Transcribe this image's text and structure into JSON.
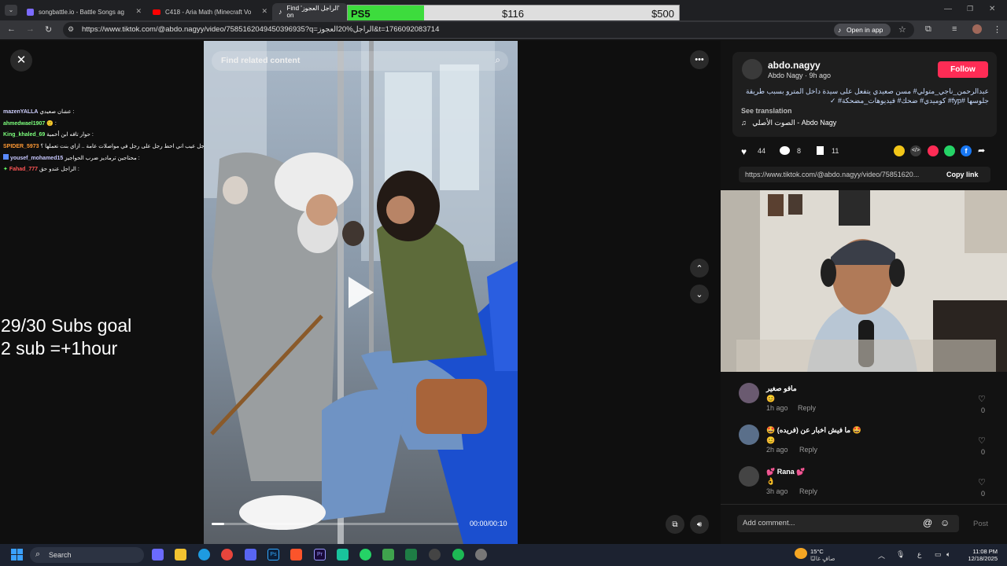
{
  "browser": {
    "tabs": [
      {
        "title": "songbattle.io - Battle Songs ag",
        "icon": "songbattle-icon"
      },
      {
        "title": "C418 - Aria Math (Minecraft Vo",
        "icon": "youtube-icon"
      },
      {
        "title": "Find 'الراجل العجوز' on",
        "icon": "tiktok-icon"
      }
    ],
    "url": "https://www.tiktok.com/@abdo.nagyy/video/7585162049450396935?q=الراجل%20العجوز&t=1766092083714",
    "open_in_app": "Open in app"
  },
  "overlay": {
    "goal_label": "PS5",
    "current": "$116",
    "target": "$500",
    "progress_fraction": 0.23
  },
  "stream": {
    "subs_goal": "29/30 Subs goal",
    "sub_rule": "2 sub =+1hour",
    "chat": [
      {
        "user": "mazenYALLA",
        "text": "عشان صعيدي :",
        "color": "#d0d0ff"
      },
      {
        "user": "ahmedwael1907",
        "text": "🙂 :",
        "color": "#7dff7d"
      },
      {
        "user": "King_khaled_69",
        "text": "حوار تافه ابن أخمية :",
        "color": "#7dff7d"
      },
      {
        "user": "SPIDER_5973",
        "text": "ما كراجل عيب اني احط رجل على رجل في مواصلات عامة .. ازاي بنت تعملها ؟ :",
        "color": "#ff9933"
      },
      {
        "user": "yousef_mohamed15",
        "text": "محتاجين ترماديز ضرب الحواجيز :",
        "color": "#c8c8ff"
      },
      {
        "user": "Fahad_777",
        "text": "الراجل عندو حق :",
        "color": "#ff5555"
      }
    ]
  },
  "video": {
    "search_placeholder": "Find related content",
    "time": "00:00/00:10",
    "progress_fraction": 0.05
  },
  "post": {
    "username": "abdo.nagyy",
    "display_name": "Abdo Nagy",
    "posted": "9h ago",
    "follow": "Follow",
    "caption": "عبدالرحمن_ناجي_متولي# مسن صعيدي يتفعل على سيدة داخل المترو بسبب طريقة جلوسها #fyp# كوميدي# ضحك# فيديوهات_مضحكة# ✓",
    "see_translation": "See translation",
    "sound": "الصوت الأصلي - Abdo Nagy",
    "likes": "44",
    "comments": "8",
    "saves": "11",
    "link": "https://www.tiktok.com/@abdo.nagyy/video/75851620...",
    "copy_link": "Copy link"
  },
  "comments": [
    {
      "name": "مافو صغير",
      "text": "😊",
      "time": "1h ago",
      "reply": "Reply",
      "likes": "0",
      "avatar": "#6a5a70"
    },
    {
      "name": "🤩 ما فيش اخبار عن (فريده) 🤩",
      "text": "😊",
      "time": "2h ago",
      "reply": "Reply",
      "likes": "0",
      "avatar": "#5a6f8a"
    },
    {
      "name": "💕 Rana 💕",
      "text": "👌",
      "time": "3h ago",
      "reply": "Reply",
      "likes": "0",
      "avatar": "#444"
    }
  ],
  "comment_box": {
    "placeholder": "Add comment...",
    "post": "Post"
  },
  "taskbar": {
    "search": "Search",
    "weather_temp": "15°C",
    "weather_desc": "صافٍ غالبًا",
    "lang": "ع",
    "time": "11:08 PM",
    "date": "12/18/2025"
  }
}
